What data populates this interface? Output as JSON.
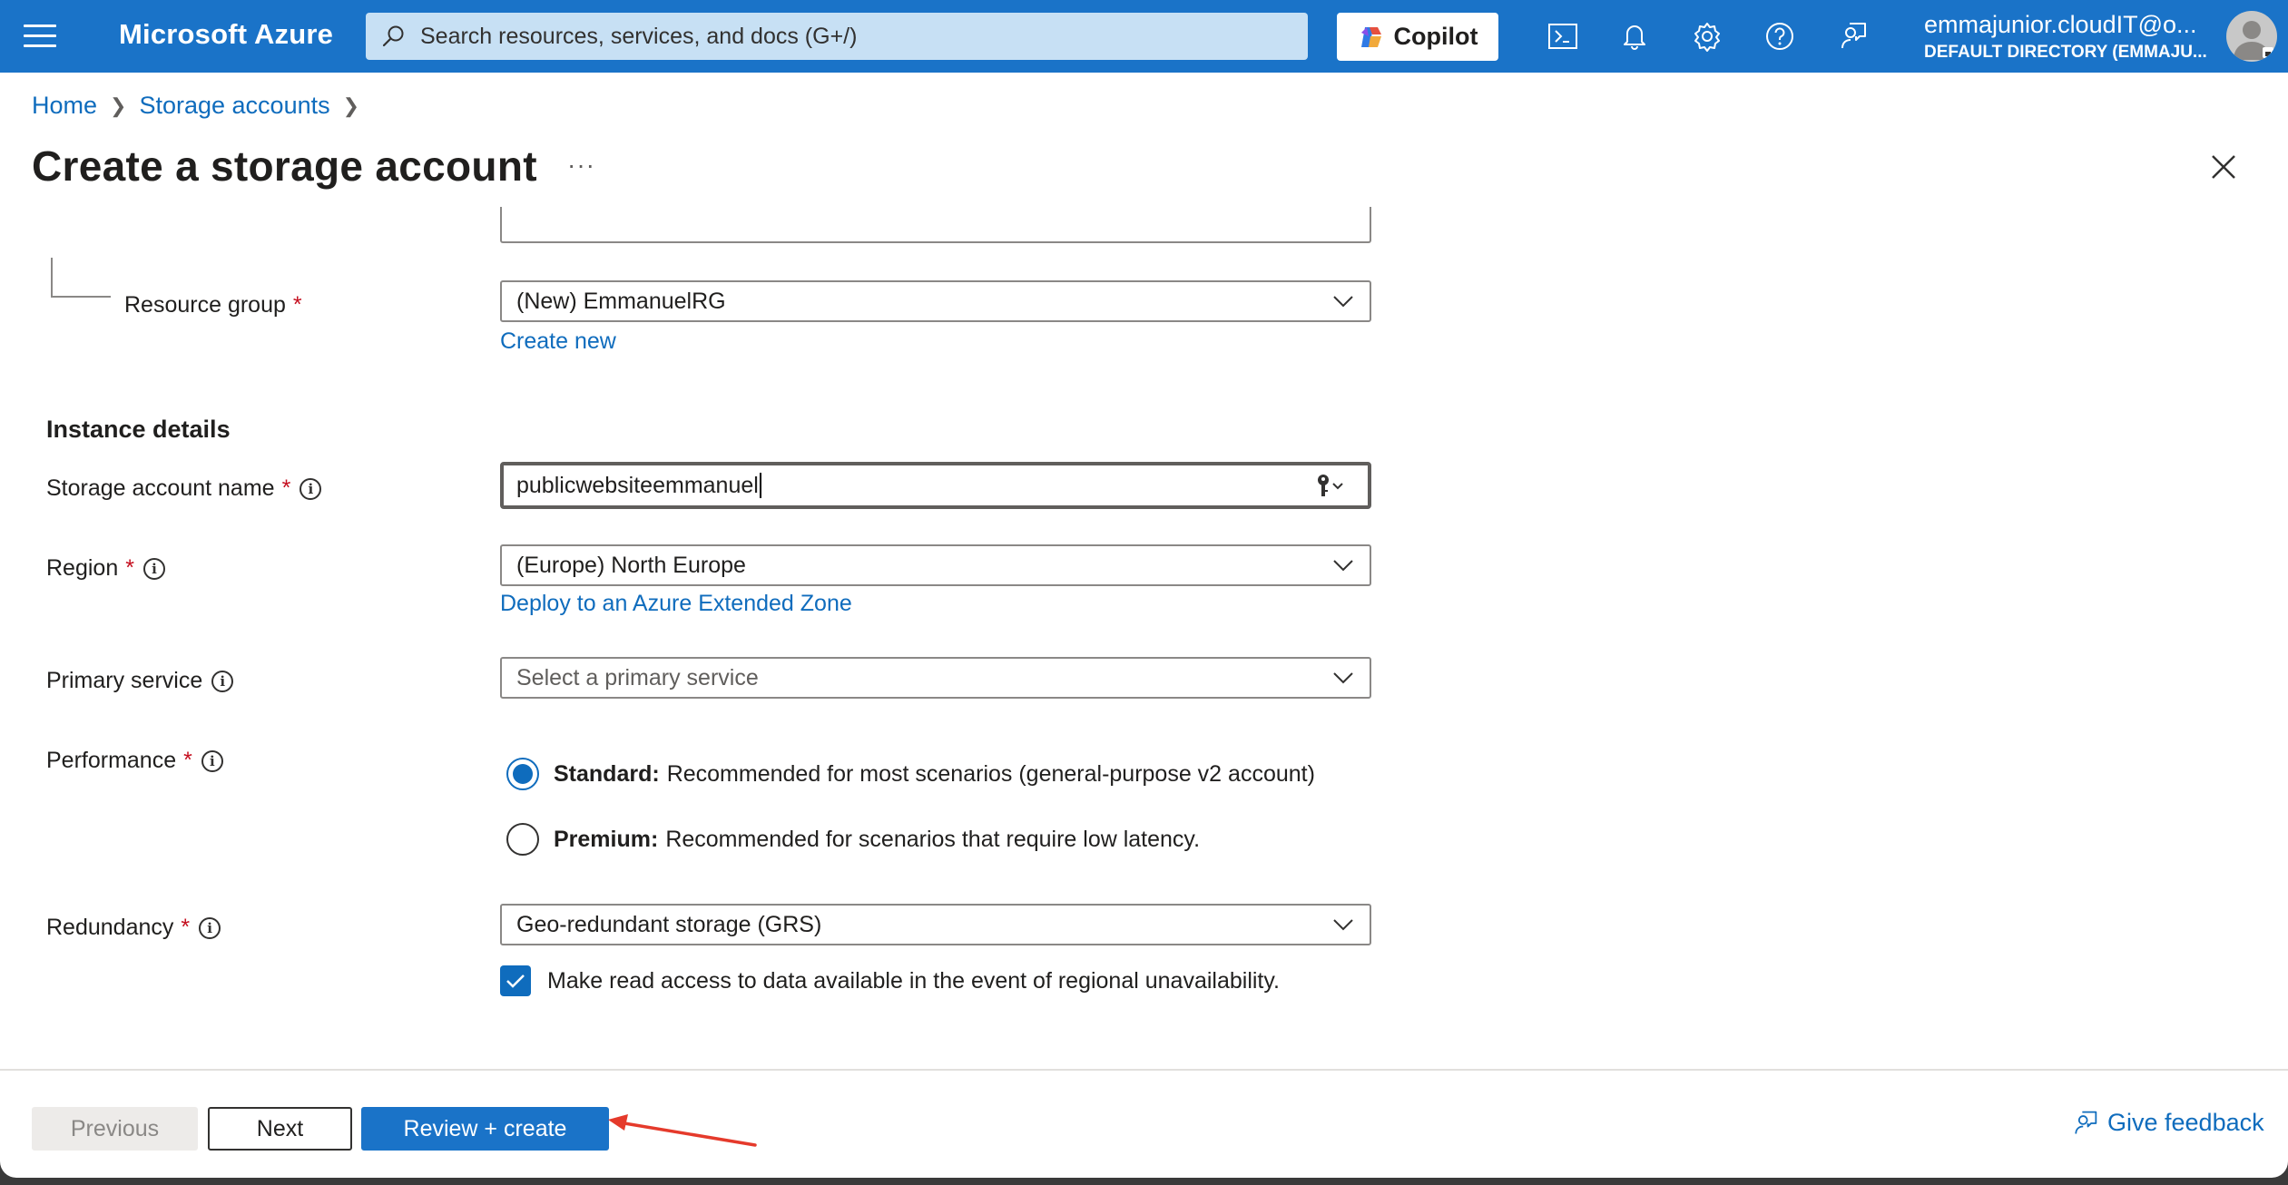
{
  "topbar": {
    "brand": "Microsoft Azure",
    "search_placeholder": "Search resources, services, and docs (G+/)",
    "copilot_label": "Copilot",
    "account_name": "emmajunior.cloudIT@o...",
    "account_directory": "DEFAULT DIRECTORY (EMMAJU..."
  },
  "breadcrumb": {
    "items": [
      "Home",
      "Storage accounts"
    ]
  },
  "header": {
    "title": "Create a storage account",
    "more": "···"
  },
  "form": {
    "resource_group": {
      "label": "Resource group",
      "required": "*",
      "value": "(New) EmmanuelRG",
      "create_new": "Create new"
    },
    "instance_section": "Instance details",
    "storage_account_name": {
      "label": "Storage account name",
      "required": "*",
      "value": "publicwebsiteemmanuel"
    },
    "region": {
      "label": "Region",
      "required": "*",
      "value": "(Europe) North Europe",
      "link": "Deploy to an Azure Extended Zone"
    },
    "primary_service": {
      "label": "Primary service",
      "placeholder": "Select a primary service"
    },
    "performance": {
      "label": "Performance",
      "required": "*",
      "options": [
        {
          "title": "Standard:",
          "desc": "Recommended for most scenarios (general-purpose v2 account)",
          "selected": true
        },
        {
          "title": "Premium:",
          "desc": "Recommended for scenarios that require low latency.",
          "selected": false
        }
      ]
    },
    "redundancy": {
      "label": "Redundancy",
      "required": "*",
      "value": "Geo-redundant storage (GRS)",
      "checkbox_label": "Make read access to data available in the event of regional unavailability.",
      "checkbox_checked": true
    }
  },
  "footer": {
    "previous": "Previous",
    "next": "Next",
    "review_create": "Review + create",
    "feedback": "Give feedback"
  },
  "colors": {
    "azure_blue": "#1a73c8",
    "link_blue": "#0f6cbd",
    "required_red": "#c50f1f",
    "annotation_arrow": "#e53a2b"
  }
}
